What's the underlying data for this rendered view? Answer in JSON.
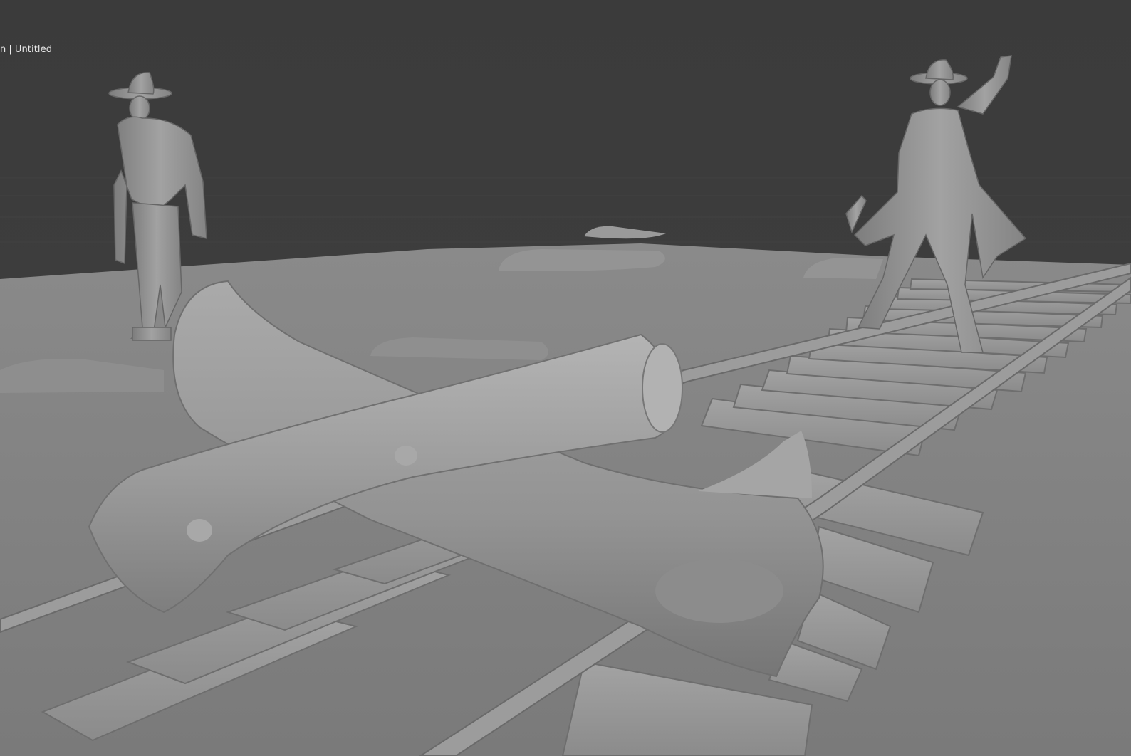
{
  "viewport": {
    "view_mode_partial": "n",
    "separator": "|",
    "collection_label": "Untitled",
    "background_color": "#3d3d3d",
    "ground_color": "#8a8a8a",
    "model_color": "#9a9a9a"
  },
  "scene_objects": [
    "cowboy-figure-left",
    "gunslinger-figure-right",
    "fallen-log-upper",
    "fallen-log-lower",
    "railroad-track",
    "sand-mounds"
  ]
}
